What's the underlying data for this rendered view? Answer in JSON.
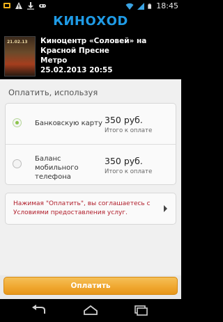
{
  "status_bar": {
    "time": "18:45",
    "left_icons": [
      "app-icon",
      "warning-icon",
      "download-icon",
      "gamepad-icon"
    ],
    "right_icons": [
      "wifi-icon",
      "signal-icon",
      "battery-icon"
    ]
  },
  "app": {
    "logo": "КИНОХОD"
  },
  "event": {
    "poster_text": "21.02.13",
    "cinema": "Киноцентр «Соловей» на Красной Пресне",
    "metro": "Метро",
    "datetime": "25.02.2013 20:55"
  },
  "payment": {
    "section_title": "Оплатить, используя",
    "options": [
      {
        "label": "Банковскую карту",
        "price": "350 руб.",
        "total_label": "Итого к оплате",
        "selected": true
      },
      {
        "label": "Баланс мобильного телефона",
        "price": "350 руб.",
        "total_label": "Итого к оплате",
        "selected": false
      }
    ],
    "terms_text": "Нажимая \"Оплатить\", вы соглашаетесь с Условиями предоставления услуг.",
    "pay_button": "Оплатить"
  },
  "nav": [
    "back-icon",
    "home-icon",
    "recent-apps-icon"
  ],
  "colors": {
    "logo": "#1f9be6",
    "button": "#f0a831",
    "terms_text": "#b01d2a",
    "radio_selected": "#8bc34a"
  }
}
